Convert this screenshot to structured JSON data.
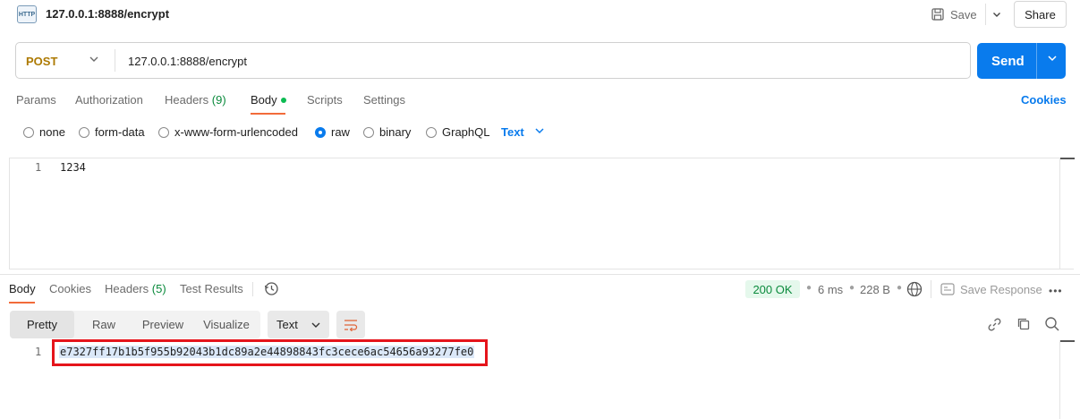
{
  "topbar": {
    "icon_text": "HTTP",
    "title": "127.0.0.1:8888/encrypt",
    "save_label": "Save",
    "share_label": "Share"
  },
  "request": {
    "method": "POST",
    "url": "127.0.0.1:8888/encrypt",
    "send_label": "Send"
  },
  "request_tabs": {
    "params": "Params",
    "authorization": "Authorization",
    "headers": "Headers",
    "headers_count": "(9)",
    "body": "Body",
    "scripts": "Scripts",
    "settings": "Settings",
    "cookies": "Cookies"
  },
  "body_types": {
    "none": "none",
    "form_data": "form-data",
    "urlencoded": "x-www-form-urlencoded",
    "raw": "raw",
    "binary": "binary",
    "graphql": "GraphQL",
    "selected": "raw",
    "format": "Text"
  },
  "request_body": {
    "line_number": "1",
    "content": "1234"
  },
  "response_tabs": {
    "body": "Body",
    "cookies": "Cookies",
    "headers": "Headers",
    "headers_count": "(5)",
    "test_results": "Test Results"
  },
  "response_meta": {
    "status": "200 OK",
    "time": "6 ms",
    "size": "228 B",
    "save_response": "Save Response"
  },
  "response_view": {
    "pretty": "Pretty",
    "raw": "Raw",
    "preview": "Preview",
    "visualize": "Visualize",
    "format": "Text"
  },
  "response_body": {
    "line_number": "1",
    "content": "e7327ff17b1b5f955b92043b1dc89a2e44898843fc3cece6ac54656a93277fe0"
  },
  "colors": {
    "accent": "#097bed",
    "method": "#ad7a03",
    "status_ok": "#0a8a3c",
    "tab_underline": "#f26b3a",
    "highlight_border": "#e5141b"
  }
}
